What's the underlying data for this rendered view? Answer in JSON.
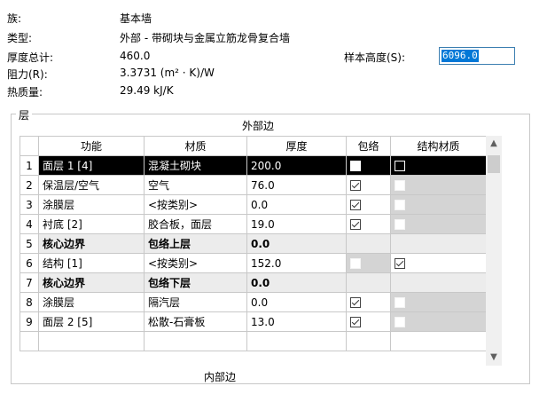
{
  "properties": {
    "family_label": "族:",
    "family_value": "基本墙",
    "type_label": "类型:",
    "type_value": "外部 - 带砌块与金属立筋龙骨复合墙",
    "thickness_label": "厚度总计:",
    "thickness_value": "460.0",
    "resistance_label": "阻力(R):",
    "resistance_value": "3.3731 (m² · K)/W",
    "thermal_label": "热质量:",
    "thermal_value": "29.49 kJ/K"
  },
  "sample_height": {
    "label": "样本高度(S):",
    "value": "6096.0"
  },
  "layers_group": {
    "title": "层",
    "outer_edge": "外部边",
    "inner_edge": "内部边",
    "columns": [
      "功能",
      "材质",
      "厚度",
      "包络",
      "结构材质"
    ],
    "rows": [
      {
        "num": "1",
        "function": "面层 1 [4]",
        "material": "混凝土砌块",
        "thickness": "200.0",
        "wrap": true,
        "structural": false,
        "selected": true,
        "core": false
      },
      {
        "num": "2",
        "function": "保温层/空气",
        "material": "空气",
        "thickness": "76.0",
        "wrap": true,
        "structural": false,
        "selected": false,
        "core": false
      },
      {
        "num": "3",
        "function": "涂膜层",
        "material": "<按类别>",
        "thickness": "0.0",
        "wrap": true,
        "structural": false,
        "selected": false,
        "core": false
      },
      {
        "num": "4",
        "function": "衬底 [2]",
        "material": "胶合板，面层",
        "thickness": "19.0",
        "wrap": true,
        "structural": false,
        "selected": false,
        "core": false
      },
      {
        "num": "5",
        "function": "核心边界",
        "material": "包络上层",
        "thickness": "0.0",
        "core": true,
        "selected": false
      },
      {
        "num": "6",
        "function": "结构 [1]",
        "material": "<按类别>",
        "thickness": "152.0",
        "wrap": false,
        "structural": true,
        "selected": false,
        "core": false
      },
      {
        "num": "7",
        "function": "核心边界",
        "material": "包络下层",
        "thickness": "0.0",
        "core": true,
        "selected": false
      },
      {
        "num": "8",
        "function": "涂膜层",
        "material": "隔汽层",
        "thickness": "0.0",
        "wrap": true,
        "structural": false,
        "selected": false,
        "core": false
      },
      {
        "num": "9",
        "function": "面层 2 [5]",
        "material": "松散-石膏板",
        "thickness": "13.0",
        "wrap": true,
        "structural": false,
        "selected": false,
        "core": false
      }
    ]
  }
}
